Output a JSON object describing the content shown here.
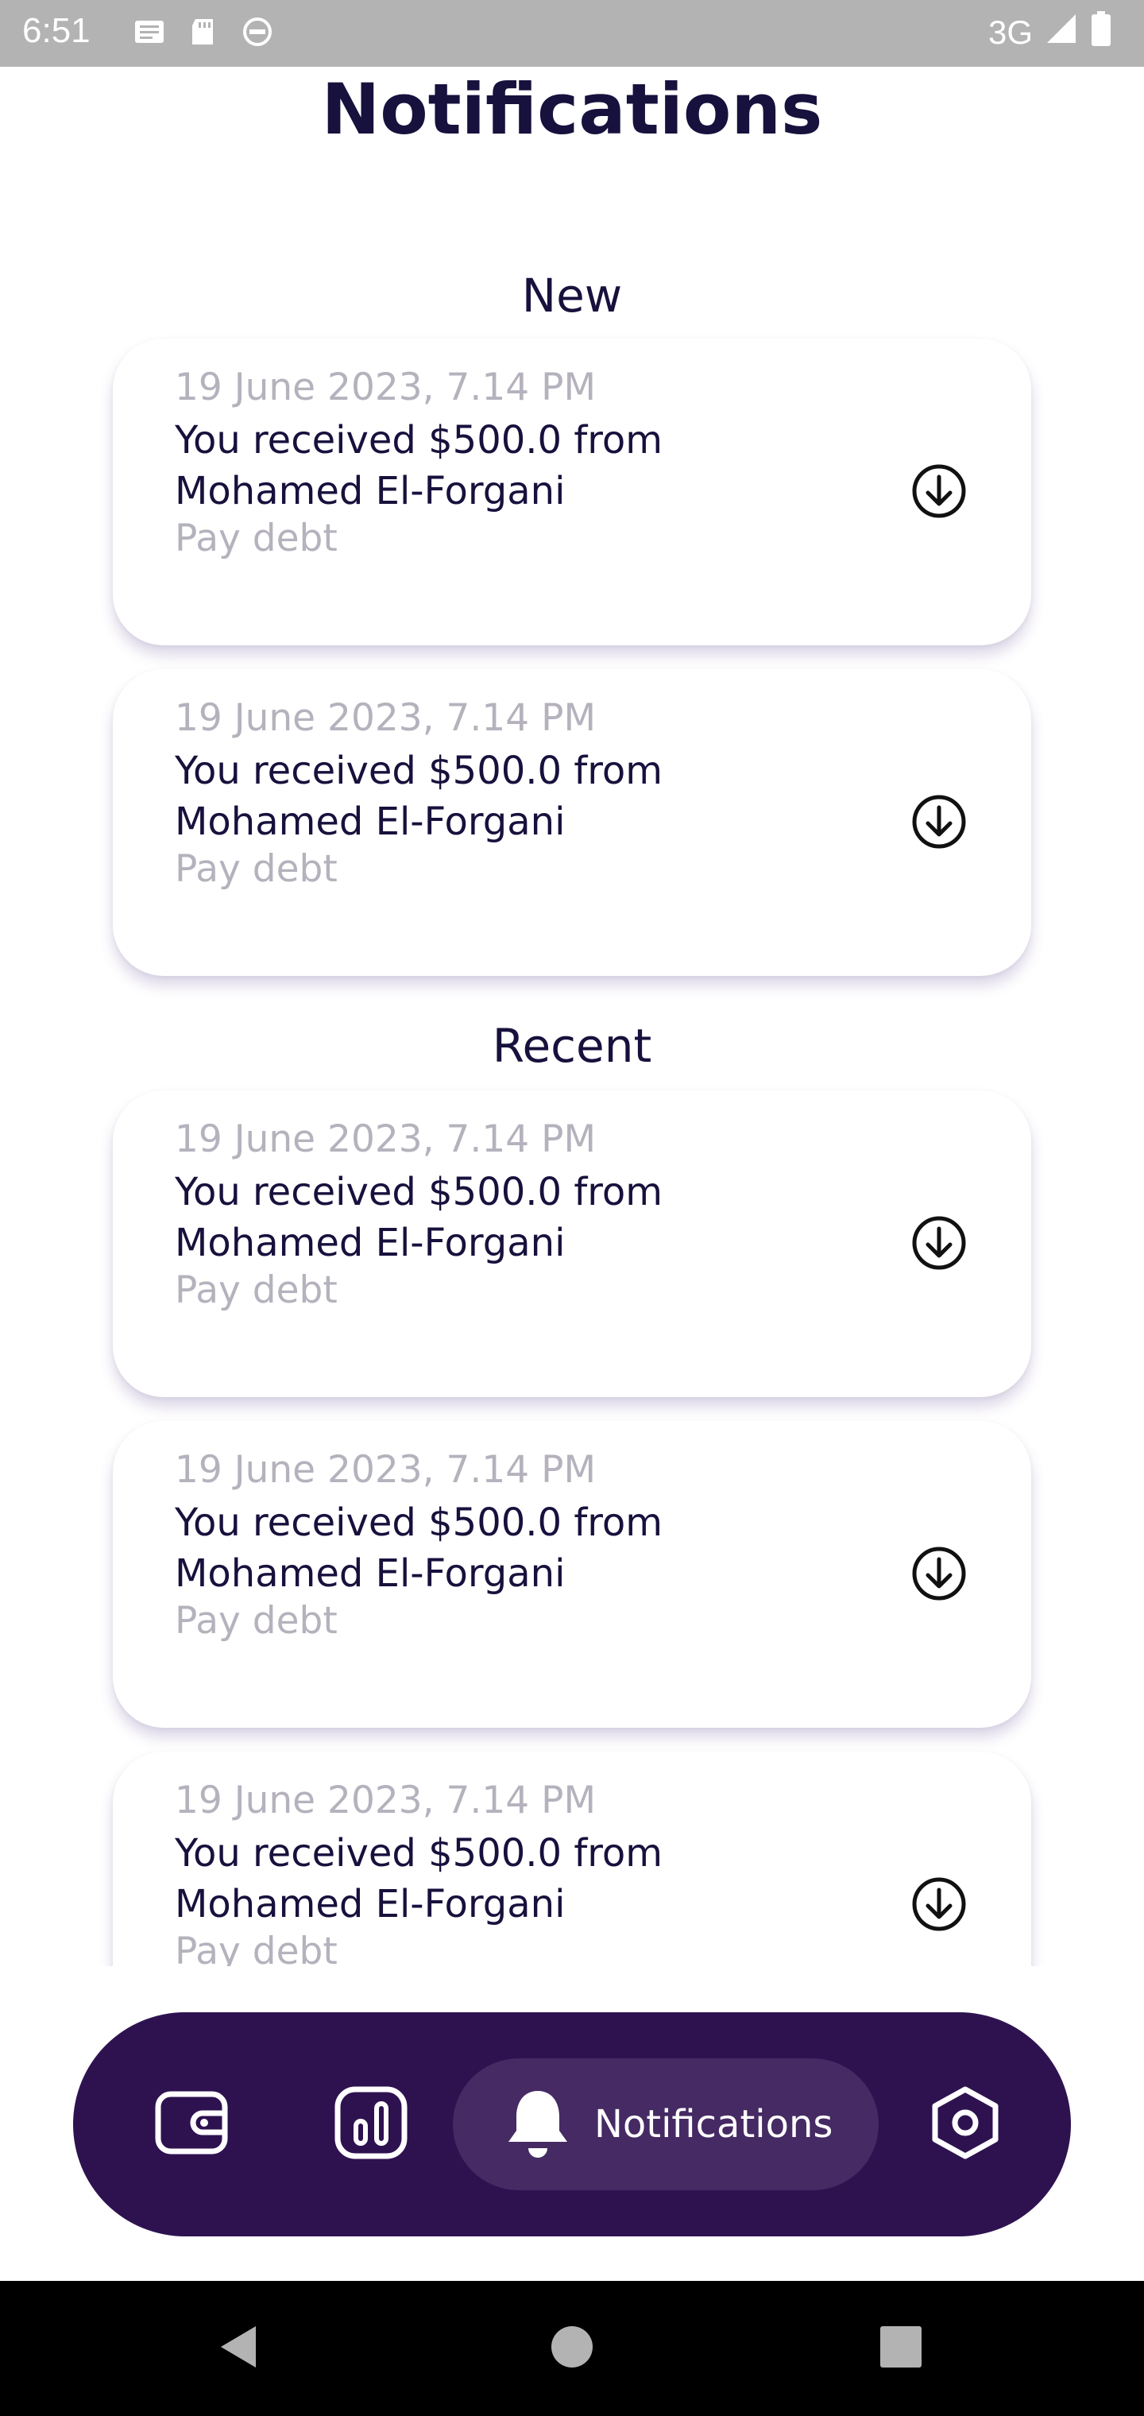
{
  "status_bar": {
    "time": "6:51",
    "network": "3G",
    "icons": [
      "notes-icon",
      "sd-card-icon",
      "vpn-icon",
      "signal-icon",
      "battery-icon"
    ]
  },
  "header": {
    "title": "Notifications"
  },
  "sections": {
    "new": {
      "title": "New",
      "items": [
        {
          "date": "19 June 2023, 7.14 PM",
          "message": "You received $500.0 from Mohamed El-Forgani",
          "subtitle": "Pay debt",
          "icon": "download-circle-icon"
        },
        {
          "date": "19 June 2023, 7.14 PM",
          "message": "You received $500.0 from Mohamed El-Forgani",
          "subtitle": "Pay debt",
          "icon": "download-circle-icon"
        }
      ]
    },
    "recent": {
      "title": "Recent",
      "items": [
        {
          "date": "19 June 2023, 7.14 PM",
          "message": "You received $500.0 from Mohamed El-Forgani",
          "subtitle": "Pay debt",
          "icon": "download-circle-icon"
        },
        {
          "date": "19 June 2023, 7.14 PM",
          "message": "You received $500.0 from Mohamed El-Forgani",
          "subtitle": "Pay debt",
          "icon": "download-circle-icon"
        },
        {
          "date": "19 June 2023, 7.14 PM",
          "message": "You received $500.0 from Mohamed El-Forgani",
          "subtitle": "Pay debt",
          "icon": "download-circle-icon"
        }
      ]
    }
  },
  "bottom_nav": {
    "items": [
      {
        "icon": "wallet-icon"
      },
      {
        "icon": "chart-icon"
      },
      {
        "icon": "bell-icon",
        "label": "Notifications",
        "active": true
      },
      {
        "icon": "settings-hexagon-icon"
      }
    ]
  },
  "colors": {
    "title": "#17113d",
    "muted_text": "#b5b2bd",
    "nav_background": "#2e1250",
    "nav_active": "#452a63",
    "status_bar": "#b3b3b3"
  }
}
